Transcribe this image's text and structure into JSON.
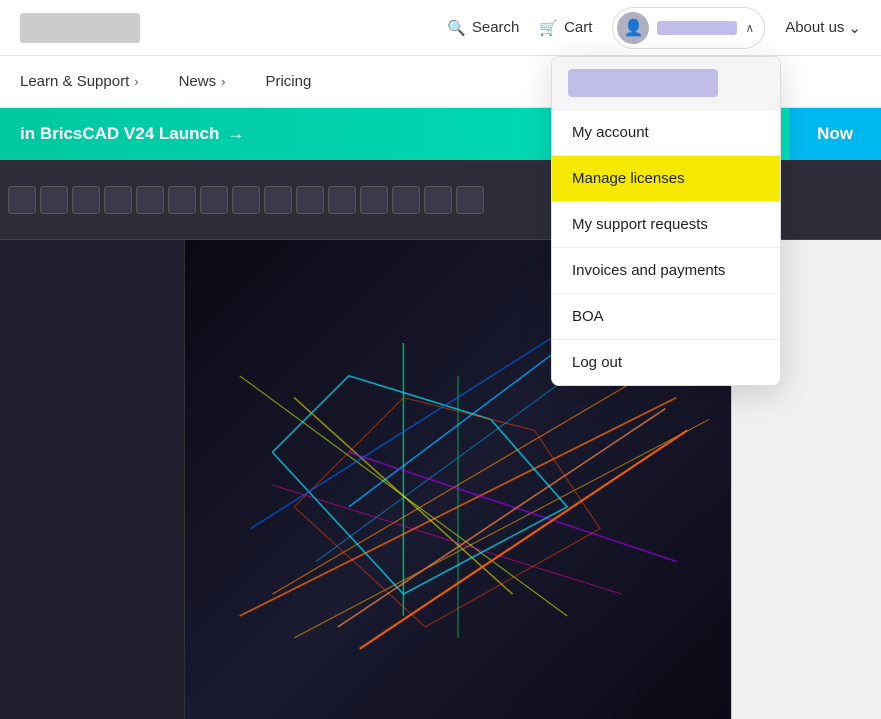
{
  "topNav": {
    "search_label": "Search",
    "cart_label": "Cart",
    "about_label": "About us",
    "user_name_placeholder": ""
  },
  "secondaryNav": {
    "items": [
      {
        "label": "Learn & Support",
        "arrow": "›"
      },
      {
        "label": "News",
        "arrow": "›"
      },
      {
        "label": "Pricing"
      }
    ]
  },
  "banner": {
    "text": "in BricsCAD V24 Launch",
    "arrow": "→",
    "cta_label": "Now"
  },
  "dropdown": {
    "username_placeholder": "",
    "items": [
      {
        "id": "my-account",
        "label": "My account",
        "active": false
      },
      {
        "id": "manage-licenses",
        "label": "Manage licenses",
        "active": true
      },
      {
        "id": "my-support",
        "label": "My support requests",
        "active": false
      },
      {
        "id": "invoices",
        "label": "Invoices and payments",
        "active": false
      },
      {
        "id": "boa",
        "label": "BOA",
        "active": false
      },
      {
        "id": "logout",
        "label": "Log out",
        "active": false
      }
    ]
  },
  "icons": {
    "search": "🔍",
    "cart": "🛒",
    "user": "👤",
    "chevron_down": "⌄",
    "chevron_right": "›"
  }
}
